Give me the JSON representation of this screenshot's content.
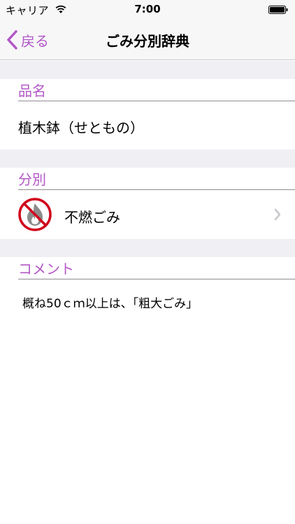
{
  "status_bar": {
    "carrier": "キャリア",
    "time": "7:00"
  },
  "nav": {
    "back_label": "戻る",
    "title": "ごみ分別辞典"
  },
  "item_section": {
    "header": "品名",
    "value": "植木鉢（せともの）"
  },
  "category_section": {
    "header": "分別",
    "value": "不燃ごみ",
    "icon": "no-burn-icon"
  },
  "comment_section": {
    "header": "コメント",
    "value": "概ね50ｃｍ以上は、「粗大ごみ」"
  },
  "colors": {
    "accent": "#b257c7",
    "prohibited_red": "#d0021b",
    "flame_gray": "#8c8c8c",
    "group_background": "#efeff4"
  }
}
